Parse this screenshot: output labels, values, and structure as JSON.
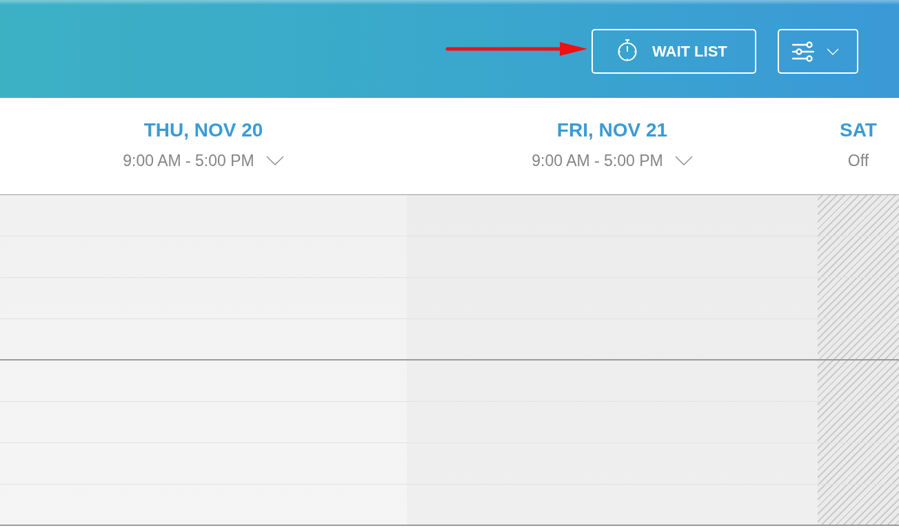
{
  "toolbar": {
    "wait_list_button": {
      "label": "WAIT LIST"
    }
  },
  "days": [
    {
      "date": "THU, NOV 20",
      "hours": "9:00 AM - 5:00 PM",
      "off": false
    },
    {
      "date": "FRI, NOV 21",
      "hours": "9:00 AM - 5:00 PM",
      "off": false
    },
    {
      "date": "SAT",
      "hours": "Off",
      "off": true
    }
  ]
}
